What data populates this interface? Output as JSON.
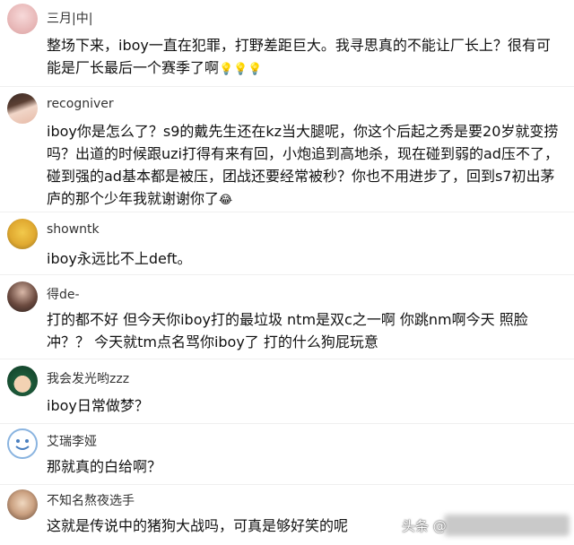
{
  "comments": [
    {
      "username": "三月|中|",
      "text": "整场下来，iboy一直在犯罪，打野差距巨大。我寻思真的不能让厂长上？很有可能是厂长最后一个赛季了啊",
      "emoji": "💡💡💡",
      "avatar": "avatar-pink-circle"
    },
    {
      "username": "recogniver",
      "text": "iboy你是怎么了？s9的戴先生还在kz当大腿呢，你这个后起之秀是要20岁就变捞吗？出道的时候跟uzi打得有来有回，小炮追到高地杀，现在碰到弱的ad压不了，碰到强的ad基本都是被压，团战还要经常被秒？你也不用进步了，回到s7初出茅庐的那个少年我就谢谢你了",
      "emoji": "😂",
      "avatar": "avatar-anime-girl"
    },
    {
      "username": "showntk",
      "text": "iboy永远比不上deft。",
      "emoji": "",
      "avatar": "avatar-cartoon-glasses"
    },
    {
      "username": "得de-",
      "text": "打的都不好 但今天你iboy打的最垃圾 ntm是双c之一啊 你跳nm啊今天 照脸冲？？ 今天就tm点名骂你iboy了 打的什么狗屁玩意",
      "emoji": "",
      "avatar": "avatar-woman-dark"
    },
    {
      "username": "我会发光哟zzz",
      "text": "iboy日常做梦？",
      "emoji": "",
      "avatar": "avatar-anime-boy"
    },
    {
      "username": "艾瑞李娅",
      "text": "那就真的白给啊？",
      "emoji": "",
      "avatar": "avatar-smiley-blue"
    },
    {
      "username": "不知名熬夜选手",
      "text": "这就是传说中的猪狗大战吗，可真是够好笑的呢",
      "emoji": "",
      "avatar": "avatar-child"
    }
  ],
  "watermark": "头条 @"
}
